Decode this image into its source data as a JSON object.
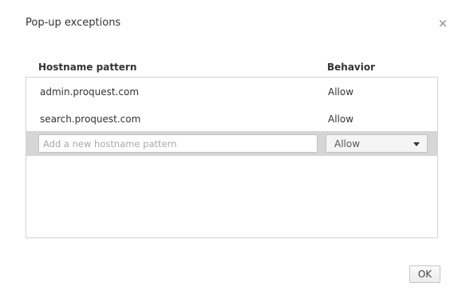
{
  "dialog": {
    "title": "Pop-up exceptions",
    "close_icon": "close-icon",
    "close_glyph": "×"
  },
  "table": {
    "headers": {
      "hostname": "Hostname pattern",
      "behavior": "Behavior"
    },
    "rows": [
      {
        "hostname": "admin.proquest.com",
        "behavior": "Allow"
      },
      {
        "hostname": "search.proquest.com",
        "behavior": "Allow"
      }
    ],
    "new_entry": {
      "placeholder": "Add a new hostname pattern",
      "value": "",
      "behavior_selected": "Allow",
      "dropdown_icon": "chevron-down-icon"
    }
  },
  "footer": {
    "ok_label": "OK"
  },
  "colors": {
    "new_row_background": "#d6d6d6",
    "border": "#d4d4d4",
    "text": "#333333"
  }
}
